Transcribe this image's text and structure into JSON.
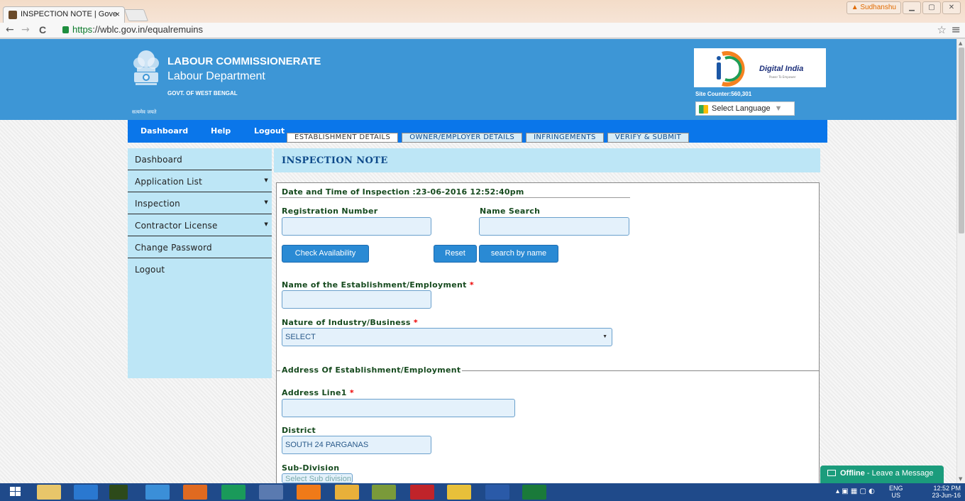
{
  "browser": {
    "tab_title": "INSPECTION NOTE | Gove",
    "tab_close": "×",
    "url_scheme": "https",
    "url_rest": "://wblc.gov.in/equalremuins",
    "user_label": "Sudhanshu",
    "back": "←",
    "forward": "→",
    "reload": "C",
    "star": "☆",
    "menu": "≡"
  },
  "header": {
    "title": "LABOUR COMMISSIONERATE",
    "subtitle": "Labour Department",
    "govt": "GOVT. OF WEST BENGAL",
    "motto": "सत्यमेव जयते",
    "digital_india": "Digital India",
    "digital_india_tag": "Power To Empower",
    "site_counter": "Site Counter:560,301",
    "language_label": "Select Language",
    "language_arrow": "▼"
  },
  "topnav": {
    "items": [
      "Dashboard",
      "Help",
      "Logout"
    ]
  },
  "sidebar": {
    "items": [
      {
        "label": "Dashboard",
        "caret": ""
      },
      {
        "label": "Application List",
        "caret": "▼"
      },
      {
        "label": "Inspection",
        "caret": "▼"
      },
      {
        "label": "Contractor License",
        "caret": "▼"
      },
      {
        "label": "Change Password",
        "caret": ""
      },
      {
        "label": "Logout",
        "caret": ""
      }
    ]
  },
  "main": {
    "title": "INSPECTION NOTE",
    "tabs": [
      "ESTABLISHMENT DETAILS",
      "OWNER/EMPLOYER DETAILS",
      "INFRINGEMENTS",
      "VERIFY & SUBMIT"
    ],
    "date_time": "Date and Time of Inspection :23-06-2016 12:52:40pm",
    "registration_label": "Registration Number",
    "registration_value": "",
    "name_search_label": "Name Search",
    "name_search_value": "",
    "check_btn": "Check Availability",
    "reset_btn": "Reset",
    "search_name_btn": "search by name",
    "establishment_label": "Name of the Establishment/Employment",
    "establishment_value": "",
    "industry_label": "Nature of Industry/Business",
    "industry_value": "SELECT",
    "required_mark": "*",
    "address_legend": "Address Of Establishment/Employment",
    "address_line1_label": "Address Line1",
    "address_line1_value": "",
    "district_label": "District",
    "district_value": "SOUTH 24 PARGANAS",
    "subdivision_label": "Sub-Division",
    "subdivision_value": "Select Sub division",
    "select_arrow": "▼"
  },
  "chat": {
    "status": "Offline",
    "message": " - Leave a Message"
  },
  "taskbar": {
    "lang_top": "ENG",
    "lang_bottom": "US",
    "time": "12:52 PM",
    "date": "23-Jun-16"
  },
  "colors": {
    "header_blue": "#3d96d6",
    "nav_blue": "#0a76ea",
    "sidebar_bg": "#bde6f6",
    "label_green": "#164a1e",
    "button_blue": "#2a8ad4",
    "chat_green": "#1b9c7c",
    "taskbar": "#1f4a8a"
  },
  "icons": {
    "tab_favicon": "emblem-icon",
    "secure": "lock-icon",
    "emblem": "ashoka-emblem-icon",
    "digital_india": "digital-india-logo",
    "translate": "google-translate-icon",
    "chat": "envelope-icon",
    "start": "windows-start-icon"
  }
}
